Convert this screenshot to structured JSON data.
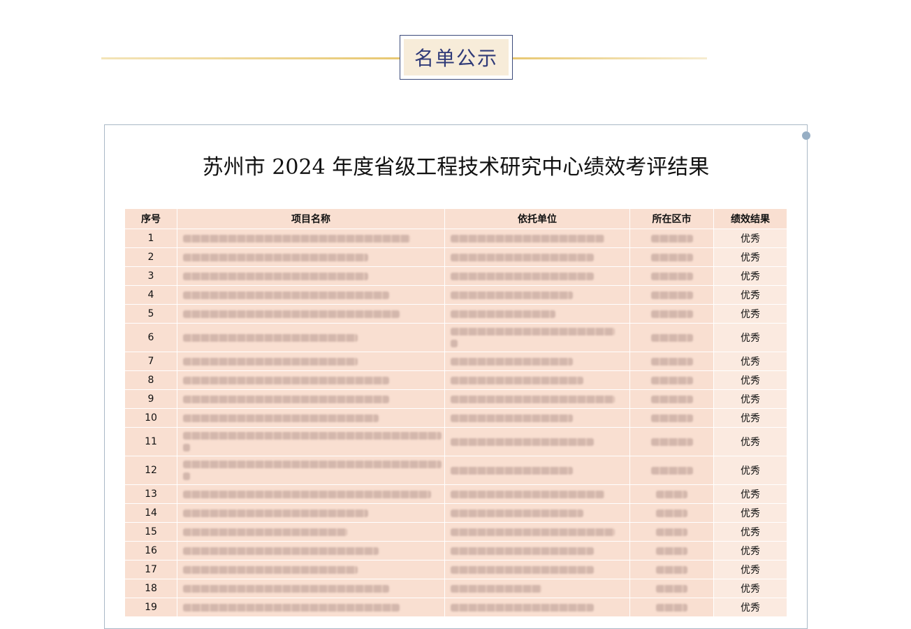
{
  "header": {
    "title": "名单公示"
  },
  "document": {
    "title": "苏州市 2024 年度省级工程技术研究中心绩效考评结果",
    "columns": [
      "序号",
      "项目名称",
      "依托单位",
      "所在区市",
      "绩效结果"
    ],
    "rows": [
      {
        "no": "1",
        "result": "优秀"
      },
      {
        "no": "2",
        "result": "优秀"
      },
      {
        "no": "3",
        "result": "优秀"
      },
      {
        "no": "4",
        "result": "优秀"
      },
      {
        "no": "5",
        "result": "优秀"
      },
      {
        "no": "6",
        "result": "优秀"
      },
      {
        "no": "7",
        "result": "优秀"
      },
      {
        "no": "8",
        "result": "优秀"
      },
      {
        "no": "9",
        "result": "优秀"
      },
      {
        "no": "10",
        "result": "优秀"
      },
      {
        "no": "11",
        "result": "优秀"
      },
      {
        "no": "12",
        "result": "优秀"
      },
      {
        "no": "13",
        "result": "优秀"
      },
      {
        "no": "14",
        "result": "优秀"
      },
      {
        "no": "15",
        "result": "优秀"
      },
      {
        "no": "16",
        "result": "优秀"
      },
      {
        "no": "17",
        "result": "优秀"
      },
      {
        "no": "18",
        "result": "优秀"
      },
      {
        "no": "19",
        "result": "优秀"
      }
    ]
  }
}
